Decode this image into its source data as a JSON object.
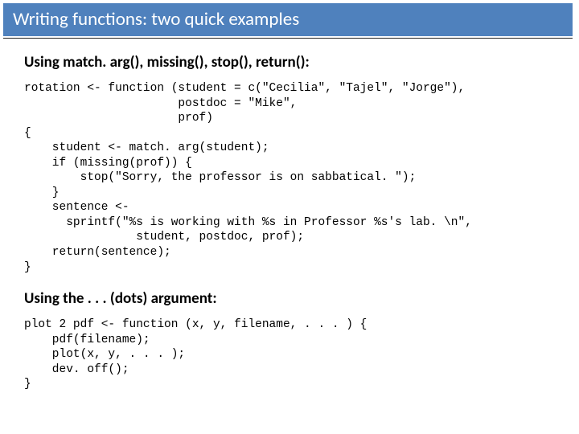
{
  "title": "Writing functions: two quick examples",
  "section1": {
    "heading": "Using match. arg(), missing(), stop(), return():",
    "code": "rotation <- function (student = c(\"Cecilia\", \"Tajel\", \"Jorge\"),\n                      postdoc = \"Mike\",\n                      prof)\n{\n    student <- match. arg(student);\n    if (missing(prof)) {\n        stop(\"Sorry, the professor is on sabbatical. \");\n    }\n    sentence <-\n      sprintf(\"%s is working with %s in Professor %s's lab. \\n\",\n                student, postdoc, prof);\n    return(sentence);\n}"
  },
  "section2": {
    "heading": "Using the . . . (dots) argument:",
    "code": "plot 2 pdf <- function (x, y, filename, . . . ) {\n    pdf(filename);\n    plot(x, y, . . . );\n    dev. off();\n}"
  }
}
